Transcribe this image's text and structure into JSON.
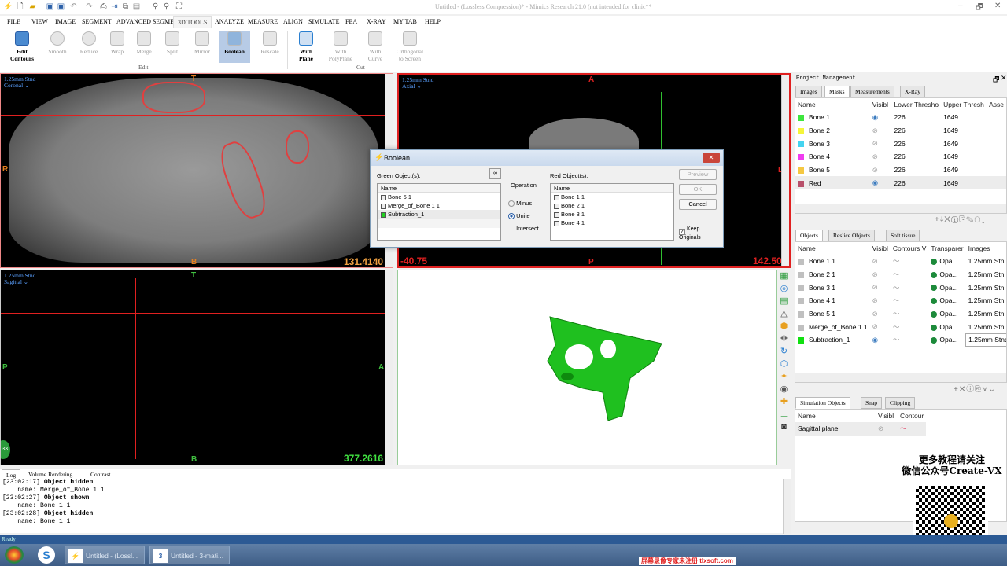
{
  "window": {
    "title": "Untitled - (Lossless Compression)* - Mimics Research 21.0 (not intended for clinic**",
    "minimize": "–",
    "restore": "🗗",
    "close": "✕"
  },
  "menu": [
    "FILE",
    "VIEW",
    "IMAGE",
    "SEGMENT",
    "ADVANCED SEGMENT",
    "3D TOOLS",
    "ANALYZE",
    "MEASURE",
    "ALIGN",
    "SIMULATE",
    "FEA",
    "X-RAY",
    "MY TAB",
    "HELP"
  ],
  "ribbon": {
    "edit": [
      {
        "label": "Edit\nContours",
        "l1": "Edit",
        "l2": "Contours"
      },
      {
        "l1": "Smooth"
      },
      {
        "l1": "Reduce"
      },
      {
        "l1": "Wrap"
      },
      {
        "l1": "Merge"
      },
      {
        "l1": "Split"
      },
      {
        "l1": "Mirror"
      },
      {
        "l1": "Boolean"
      },
      {
        "l1": "Rescale"
      }
    ],
    "cut": [
      {
        "l1": "With",
        "l2": "Plane"
      },
      {
        "l1": "With",
        "l2": "PolyPlane"
      },
      {
        "l1": "With",
        "l2": "Curve"
      },
      {
        "l1": "Orthogonal",
        "l2": "to Screen"
      }
    ],
    "edit_group": "Edit",
    "cut_group": "Cut"
  },
  "viewports": {
    "coronal": {
      "scan": "1.25mm Stnd",
      "view": "Coronal ⌄",
      "top": "T",
      "bottom": "B",
      "left": "R",
      "right": "L",
      "value": "131.4140"
    },
    "axial": {
      "scan": "1.25mm Stnd",
      "view": "Axial ⌄",
      "top": "A",
      "bottom": "P",
      "left_value": "-40.75",
      "right_value": "142.50",
      "right": "L"
    },
    "sagittal": {
      "scan": "1.25mm Stnd",
      "view": "Sagittal ⌄",
      "top": "T",
      "bottom": "B",
      "left": "P",
      "right": "A",
      "value": "377.2616",
      "badge": "33"
    }
  },
  "dialog": {
    "title": "Boolean",
    "green_label": "Green Object(s):",
    "red_label": "Red Object(s):",
    "operation_label": "Operation",
    "col": "Name",
    "green_items": [
      "Bone 5 1",
      "Merge_of_Bone 1 1",
      "Subtraction_1"
    ],
    "red_items": [
      "Bone 1 1",
      "Bone 2 1",
      "Bone 3 1",
      "Bone 4 1"
    ],
    "ops": [
      "Minus",
      "Unite",
      "Intersect"
    ],
    "selected_op": "Unite",
    "preview": "Preview",
    "ok": "OK",
    "cancel": "Cancel",
    "keep": "Keep\nOriginals",
    "keep_l1": "Keep",
    "keep_l2": "Originals",
    "keep_checked": true
  },
  "project": {
    "title": "Project Management",
    "tabs": [
      "Images",
      "Masks",
      "Measurements",
      "X-Ray"
    ],
    "mask_cols": [
      "Name",
      "Visibl",
      "Lower Thresho",
      "Upper Thresh",
      "Asse"
    ],
    "masks": [
      {
        "name": "Bone 1",
        "color": "#3ee63e",
        "visible": true,
        "lower": "226",
        "upper": "1649"
      },
      {
        "name": "Bone 2",
        "color": "#f5f53a",
        "visible": false,
        "lower": "226",
        "upper": "1649"
      },
      {
        "name": "Bone 3",
        "color": "#44d4f0",
        "visible": false,
        "lower": "226",
        "upper": "1649"
      },
      {
        "name": "Bone 4",
        "color": "#f03cf0",
        "visible": false,
        "lower": "226",
        "upper": "1649"
      },
      {
        "name": "Bone 5",
        "color": "#f5c842",
        "visible": false,
        "lower": "226",
        "upper": "1649"
      },
      {
        "name": "Red",
        "color": "#b8506a",
        "visible": true,
        "lower": "226",
        "upper": "1649"
      }
    ]
  },
  "objects": {
    "tabs": [
      "Objects",
      "Reslice Objects",
      "Soft tissue"
    ],
    "cols": [
      "Name",
      "Visibl",
      "Contours V",
      "Transparer",
      "Images"
    ],
    "rows": [
      {
        "name": "Bone 1 1",
        "color": "#c0c0c0",
        "visible": false,
        "trans": "Opa...",
        "image": "1.25mm Stn"
      },
      {
        "name": "Bone 2 1",
        "color": "#c0c0c0",
        "visible": false,
        "trans": "Opa...",
        "image": "1.25mm Stn"
      },
      {
        "name": "Bone 3 1",
        "color": "#c0c0c0",
        "visible": false,
        "trans": "Opa...",
        "image": "1.25mm Stn"
      },
      {
        "name": "Bone 4 1",
        "color": "#c0c0c0",
        "visible": false,
        "trans": "Opa...",
        "image": "1.25mm Stn"
      },
      {
        "name": "Bone 5 1",
        "color": "#c0c0c0",
        "visible": false,
        "trans": "Opa...",
        "image": "1.25mm Stn"
      },
      {
        "name": "Merge_of_Bone 1 1",
        "color": "#c0c0c0",
        "visible": false,
        "trans": "Opa...",
        "image": "1.25mm Stn"
      },
      {
        "name": "Subtraction_1",
        "color": "#10e010",
        "visible": true,
        "trans": "Opa...",
        "image": "1.25mm Stnd"
      }
    ]
  },
  "simulation": {
    "tabs": [
      "Simulation Objects",
      "Snap",
      "Clipping"
    ],
    "cols": [
      "Name",
      "Visibl",
      "Contour"
    ],
    "rows": [
      {
        "name": "Sagittal plane"
      }
    ]
  },
  "log": {
    "tabs": [
      "Log",
      "Volume Rendering",
      "Contrast"
    ],
    "lines": [
      {
        "time": "[23:02:17]",
        "event": "Object hidden",
        "detail": "name: Merge_of_Bone 1 1"
      },
      {
        "time": "[23:02:27]",
        "event": "Object shown",
        "detail": "name: Bone 1 1"
      },
      {
        "time": "[23:02:28]",
        "event": "Object hidden",
        "detail": "name: Bone 1 1"
      }
    ]
  },
  "status": "Ready",
  "taskbar": {
    "items": [
      "Untitled - (Lossl...",
      "Untitled - 3-mati..."
    ]
  },
  "watermark": {
    "line1": "更多教程请关注",
    "line2": "微信公众号Create-VX",
    "footer": "屏幕录像专家未注册 tlxsoft.com"
  },
  "colors": {
    "accent": "#2c5a94",
    "mask_green": "#10e010",
    "border_red": "#e02020"
  }
}
